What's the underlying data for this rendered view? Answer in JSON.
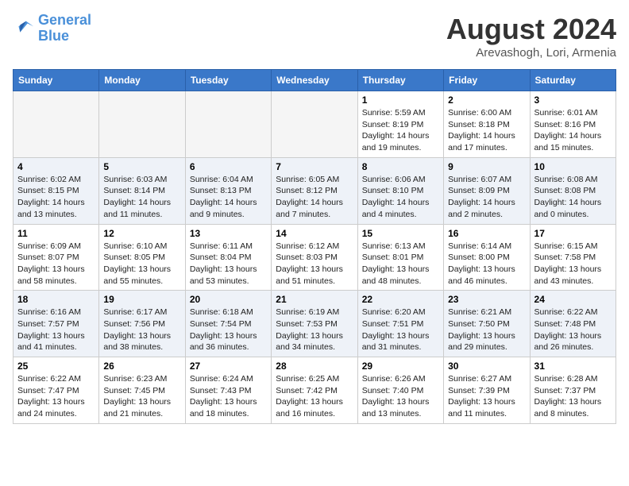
{
  "logo": {
    "line1": "General",
    "line2": "Blue"
  },
  "title": "August 2024",
  "subtitle": "Arevashogh, Lori, Armenia",
  "days": [
    "Sunday",
    "Monday",
    "Tuesday",
    "Wednesday",
    "Thursday",
    "Friday",
    "Saturday"
  ],
  "weeks": [
    [
      {
        "num": "",
        "text": ""
      },
      {
        "num": "",
        "text": ""
      },
      {
        "num": "",
        "text": ""
      },
      {
        "num": "",
        "text": ""
      },
      {
        "num": "1",
        "text": "Sunrise: 5:59 AM\nSunset: 8:19 PM\nDaylight: 14 hours\nand 19 minutes."
      },
      {
        "num": "2",
        "text": "Sunrise: 6:00 AM\nSunset: 8:18 PM\nDaylight: 14 hours\nand 17 minutes."
      },
      {
        "num": "3",
        "text": "Sunrise: 6:01 AM\nSunset: 8:16 PM\nDaylight: 14 hours\nand 15 minutes."
      }
    ],
    [
      {
        "num": "4",
        "text": "Sunrise: 6:02 AM\nSunset: 8:15 PM\nDaylight: 14 hours\nand 13 minutes."
      },
      {
        "num": "5",
        "text": "Sunrise: 6:03 AM\nSunset: 8:14 PM\nDaylight: 14 hours\nand 11 minutes."
      },
      {
        "num": "6",
        "text": "Sunrise: 6:04 AM\nSunset: 8:13 PM\nDaylight: 14 hours\nand 9 minutes."
      },
      {
        "num": "7",
        "text": "Sunrise: 6:05 AM\nSunset: 8:12 PM\nDaylight: 14 hours\nand 7 minutes."
      },
      {
        "num": "8",
        "text": "Sunrise: 6:06 AM\nSunset: 8:10 PM\nDaylight: 14 hours\nand 4 minutes."
      },
      {
        "num": "9",
        "text": "Sunrise: 6:07 AM\nSunset: 8:09 PM\nDaylight: 14 hours\nand 2 minutes."
      },
      {
        "num": "10",
        "text": "Sunrise: 6:08 AM\nSunset: 8:08 PM\nDaylight: 14 hours\nand 0 minutes."
      }
    ],
    [
      {
        "num": "11",
        "text": "Sunrise: 6:09 AM\nSunset: 8:07 PM\nDaylight: 13 hours\nand 58 minutes."
      },
      {
        "num": "12",
        "text": "Sunrise: 6:10 AM\nSunset: 8:05 PM\nDaylight: 13 hours\nand 55 minutes."
      },
      {
        "num": "13",
        "text": "Sunrise: 6:11 AM\nSunset: 8:04 PM\nDaylight: 13 hours\nand 53 minutes."
      },
      {
        "num": "14",
        "text": "Sunrise: 6:12 AM\nSunset: 8:03 PM\nDaylight: 13 hours\nand 51 minutes."
      },
      {
        "num": "15",
        "text": "Sunrise: 6:13 AM\nSunset: 8:01 PM\nDaylight: 13 hours\nand 48 minutes."
      },
      {
        "num": "16",
        "text": "Sunrise: 6:14 AM\nSunset: 8:00 PM\nDaylight: 13 hours\nand 46 minutes."
      },
      {
        "num": "17",
        "text": "Sunrise: 6:15 AM\nSunset: 7:58 PM\nDaylight: 13 hours\nand 43 minutes."
      }
    ],
    [
      {
        "num": "18",
        "text": "Sunrise: 6:16 AM\nSunset: 7:57 PM\nDaylight: 13 hours\nand 41 minutes."
      },
      {
        "num": "19",
        "text": "Sunrise: 6:17 AM\nSunset: 7:56 PM\nDaylight: 13 hours\nand 38 minutes."
      },
      {
        "num": "20",
        "text": "Sunrise: 6:18 AM\nSunset: 7:54 PM\nDaylight: 13 hours\nand 36 minutes."
      },
      {
        "num": "21",
        "text": "Sunrise: 6:19 AM\nSunset: 7:53 PM\nDaylight: 13 hours\nand 34 minutes."
      },
      {
        "num": "22",
        "text": "Sunrise: 6:20 AM\nSunset: 7:51 PM\nDaylight: 13 hours\nand 31 minutes."
      },
      {
        "num": "23",
        "text": "Sunrise: 6:21 AM\nSunset: 7:50 PM\nDaylight: 13 hours\nand 29 minutes."
      },
      {
        "num": "24",
        "text": "Sunrise: 6:22 AM\nSunset: 7:48 PM\nDaylight: 13 hours\nand 26 minutes."
      }
    ],
    [
      {
        "num": "25",
        "text": "Sunrise: 6:22 AM\nSunset: 7:47 PM\nDaylight: 13 hours\nand 24 minutes."
      },
      {
        "num": "26",
        "text": "Sunrise: 6:23 AM\nSunset: 7:45 PM\nDaylight: 13 hours\nand 21 minutes."
      },
      {
        "num": "27",
        "text": "Sunrise: 6:24 AM\nSunset: 7:43 PM\nDaylight: 13 hours\nand 18 minutes."
      },
      {
        "num": "28",
        "text": "Sunrise: 6:25 AM\nSunset: 7:42 PM\nDaylight: 13 hours\nand 16 minutes."
      },
      {
        "num": "29",
        "text": "Sunrise: 6:26 AM\nSunset: 7:40 PM\nDaylight: 13 hours\nand 13 minutes."
      },
      {
        "num": "30",
        "text": "Sunrise: 6:27 AM\nSunset: 7:39 PM\nDaylight: 13 hours\nand 11 minutes."
      },
      {
        "num": "31",
        "text": "Sunrise: 6:28 AM\nSunset: 7:37 PM\nDaylight: 13 hours\nand 8 minutes."
      }
    ]
  ]
}
